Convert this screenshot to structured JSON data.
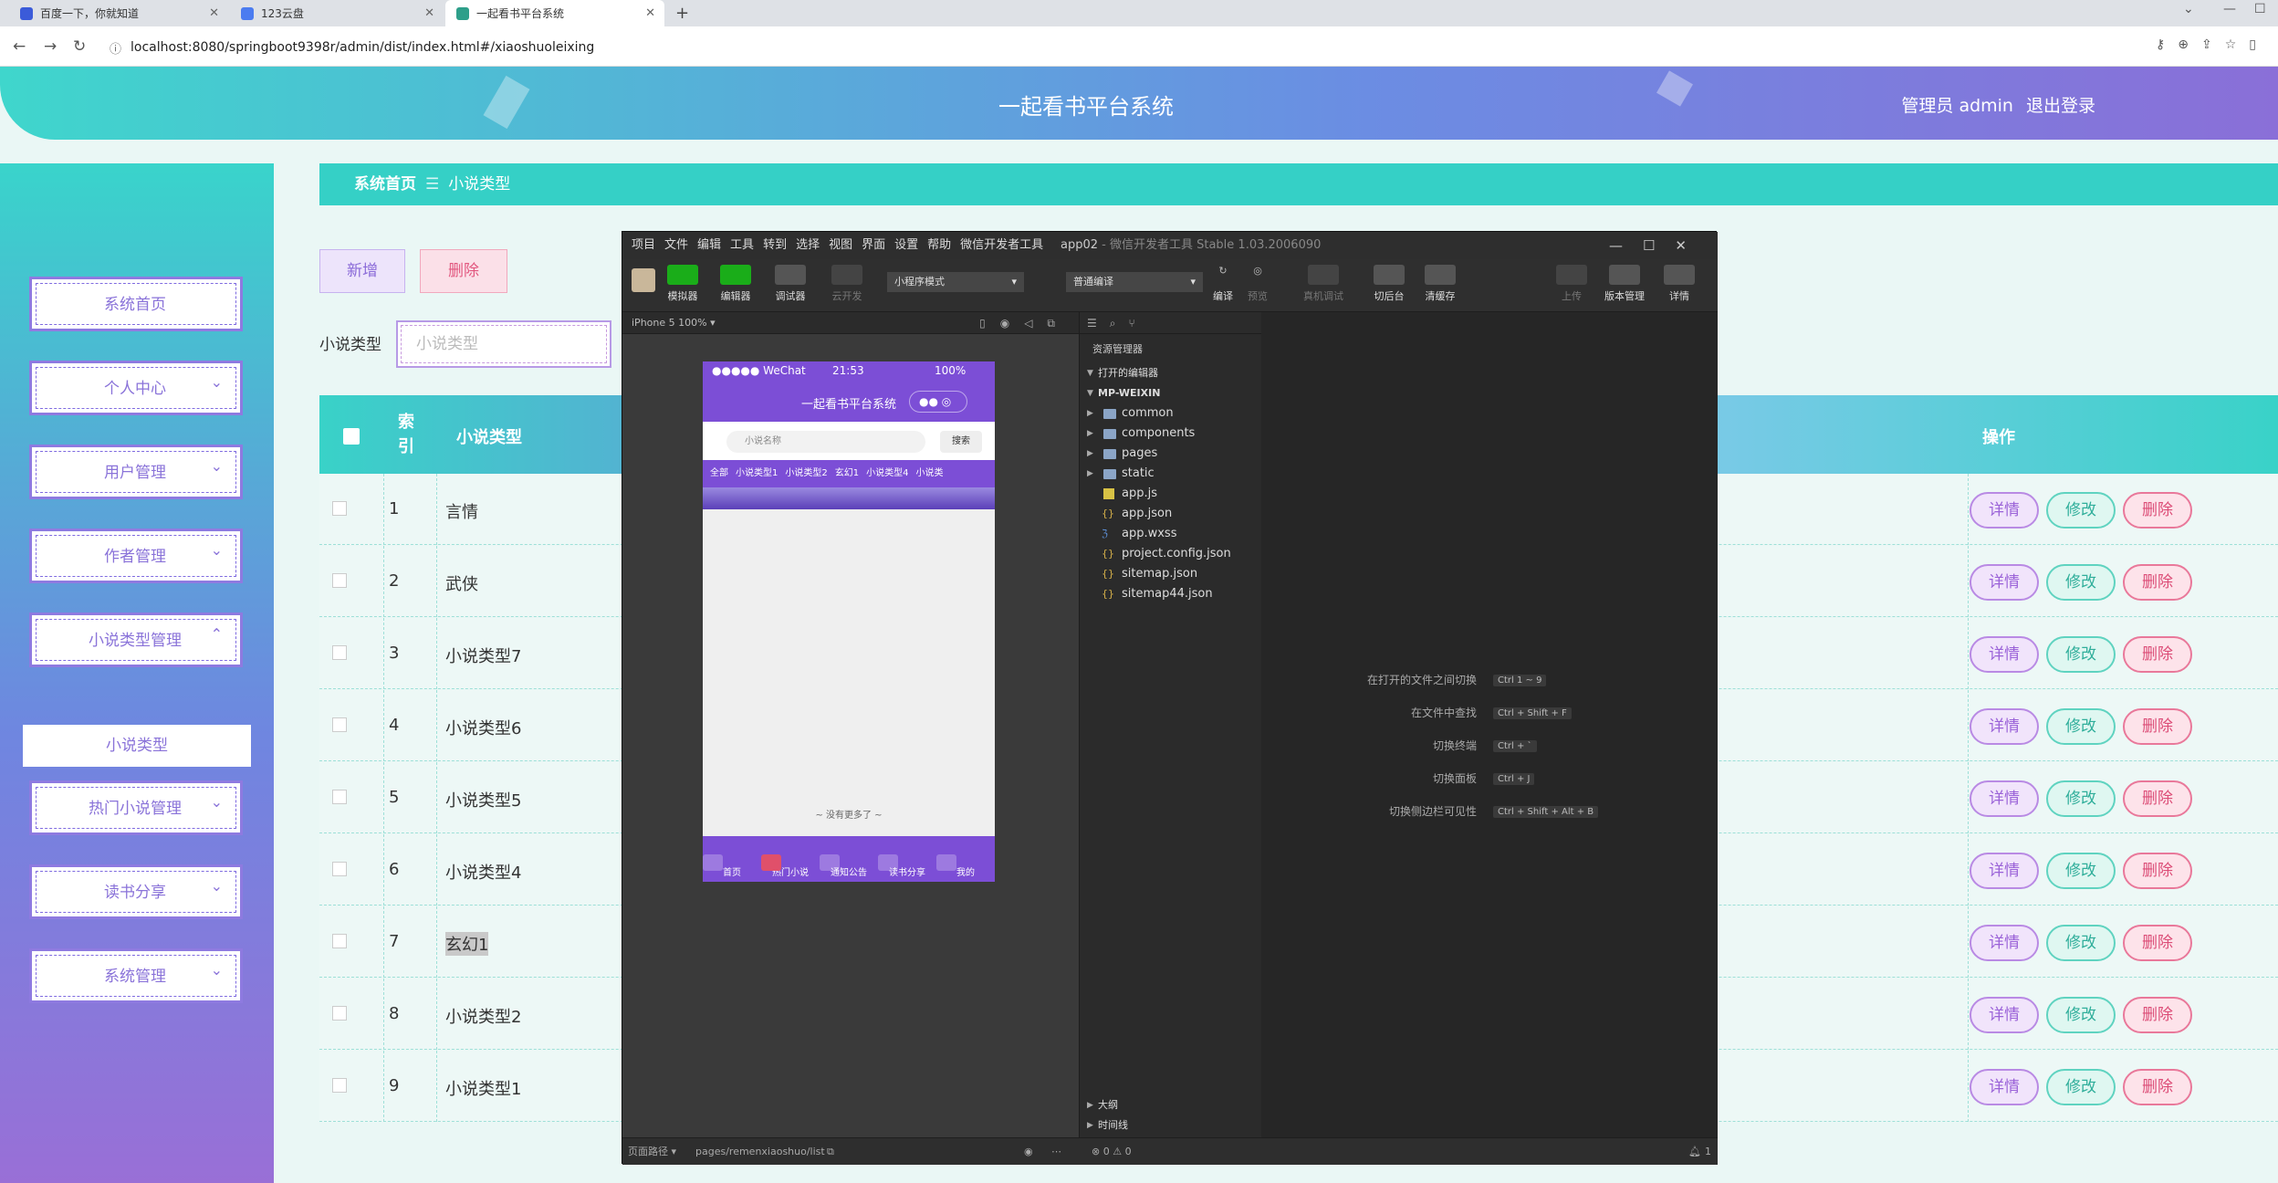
{
  "browser": {
    "tabs": [
      {
        "label": "百度一下，你就知道"
      },
      {
        "label": "123云盘"
      },
      {
        "label": "一起看书平台系统"
      }
    ],
    "url": "localhost:8080/springboot9398r/admin/dist/index.html#/xiaoshuoleixing"
  },
  "header": {
    "title": "一起看书平台系统",
    "user": "管理员 admin",
    "logout": "退出登录"
  },
  "sidebar": {
    "items": [
      {
        "label": "系统首页"
      },
      {
        "label": "个人中心"
      },
      {
        "label": "用户管理"
      },
      {
        "label": "作者管理"
      },
      {
        "label": "小说类型管理"
      },
      {
        "label": "热门小说管理"
      },
      {
        "label": "读书分享"
      },
      {
        "label": "系统管理"
      }
    ],
    "submenu": "小说类型"
  },
  "breadcrumb": {
    "home": "系统首页",
    "current": "小说类型"
  },
  "actions": {
    "add": "新增",
    "delete": "删除"
  },
  "search": {
    "label": "小说类型",
    "placeholder": "小说类型"
  },
  "table": {
    "headers": {
      "index": "索引",
      "type": "小说类型",
      "ops": "操作"
    },
    "rows": [
      {
        "idx": "1",
        "name": "言情"
      },
      {
        "idx": "2",
        "name": "武侠"
      },
      {
        "idx": "3",
        "name": "小说类型7"
      },
      {
        "idx": "4",
        "name": "小说类型6"
      },
      {
        "idx": "5",
        "name": "小说类型5"
      },
      {
        "idx": "6",
        "name": "小说类型4"
      },
      {
        "idx": "7",
        "name": "玄幻1"
      },
      {
        "idx": "8",
        "name": "小说类型2"
      },
      {
        "idx": "9",
        "name": "小说类型1"
      }
    ],
    "btn_detail": "详情",
    "btn_edit": "修改",
    "btn_delete": "删除"
  },
  "ide": {
    "menu": [
      "项目",
      "文件",
      "编辑",
      "工具",
      "转到",
      "选择",
      "视图",
      "界面",
      "设置",
      "帮助",
      "微信开发者工具"
    ],
    "title": "app02",
    "subtitle": "- 微信开发者工具 Stable 1.03.2006090",
    "toolbar": [
      "模拟器",
      "编辑器",
      "调试器",
      "云开发",
      "编译",
      "预览",
      "真机调试",
      "切后台",
      "清缓存",
      "上传",
      "版本管理",
      "详情"
    ],
    "mode": "小程序模式",
    "compile": "普通编译",
    "device": "iPhone 5 100% ▾",
    "phone": {
      "status_left": "●●●●● WeChat",
      "time": "21:53",
      "battery": "100%",
      "nav_title": "一起看书平台系统",
      "search_placeholder": "小说名称",
      "search_btn": "搜索",
      "cats": [
        "全部",
        "小说类型1",
        "小说类型2",
        "玄幻1",
        "小说类型4",
        "小说类"
      ],
      "no_more": "~ 没有更多了 ~",
      "tabs": [
        "首页",
        "热门小说",
        "通知公告",
        "读书分享",
        "我的"
      ]
    },
    "explorer": {
      "title": "资源管理器",
      "open": "打开的编辑器",
      "root": "MP-WEIXIN",
      "files": [
        "common",
        "components",
        "pages",
        "static",
        "app.js",
        "app.json",
        "app.wxss",
        "project.config.json",
        "sitemap.json",
        "sitemap44.json"
      ],
      "outline": "大纲",
      "timeline": "时间线"
    },
    "shortcuts": [
      {
        "label": "在打开的文件之间切换",
        "keys": "Ctrl  1 ~ 9"
      },
      {
        "label": "在文件中查找",
        "keys": "Ctrl + Shift + F"
      },
      {
        "label": "切换终端",
        "keys": "Ctrl + `"
      },
      {
        "label": "切换面板",
        "keys": "Ctrl + J"
      },
      {
        "label": "切换侧边栏可见性",
        "keys": "Ctrl + Shift + Alt + B"
      }
    ],
    "status_path_label": "页面路径 ▾",
    "status_path": "pages/remenxiaoshuo/list",
    "status_errors": "⊗ 0 ⚠ 0",
    "status_bell": "1"
  }
}
